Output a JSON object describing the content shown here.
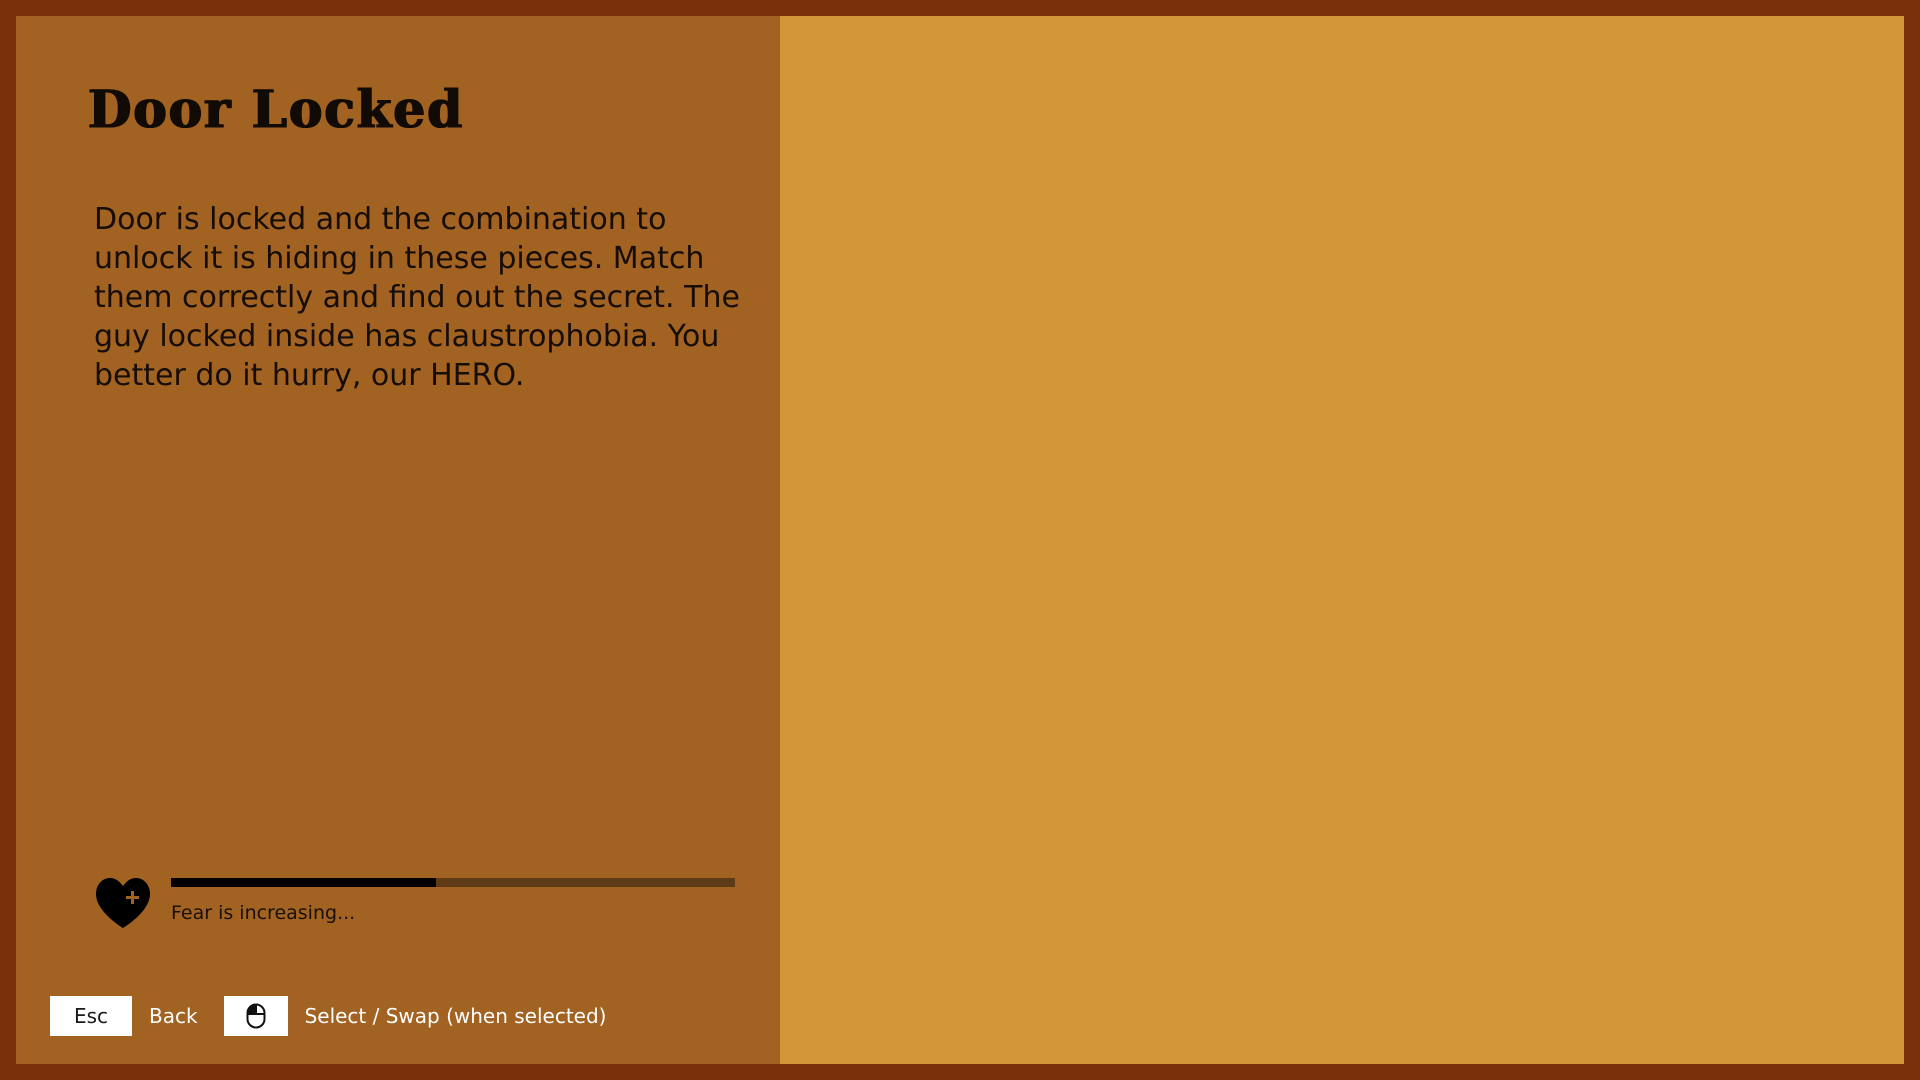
{
  "title": "Door Locked",
  "description": "Door is locked and the combination to unlock it is hiding in these pieces. Match them correctly and find out the secret. The guy locked inside has claustrophobia. You better do it hurry, our HERO.",
  "fear": {
    "icon": "heart-plus-icon",
    "level": 0.47,
    "label": "Fear is increasing..."
  },
  "controls": [
    {
      "key": "Esc",
      "action": "Back"
    },
    {
      "key_icon": "mouse-left-click-icon",
      "action": "Select / Swap (when selected)"
    }
  ],
  "colors": {
    "border": "#7a300a",
    "left_panel": "#a16222",
    "right_panel": "#d39738",
    "fear_fill": "#000000",
    "fear_track": "#5e3a16",
    "keycap": "#ffffff"
  }
}
